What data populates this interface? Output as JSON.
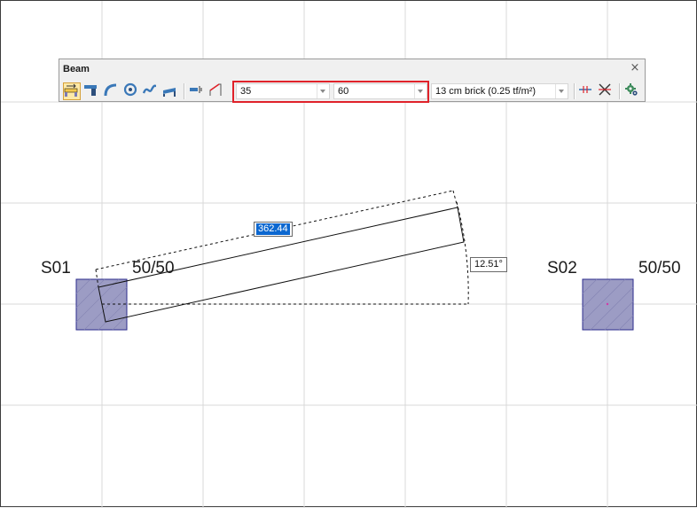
{
  "toolbar": {
    "title": "Beam",
    "close_glyph": "×",
    "width_value": "35",
    "height_value": "60",
    "wall_load_value": "13 cm brick (0.25 tf/m²)",
    "buttons": [
      {
        "icon": "straight-beam-icon",
        "active": true
      },
      {
        "icon": "cantilever-beam-icon",
        "active": false
      },
      {
        "icon": "arc-beam-icon",
        "active": false
      },
      {
        "icon": "circular-beam-icon",
        "active": false
      },
      {
        "icon": "spline-beam-icon",
        "active": false
      },
      {
        "icon": "inclined-beam-icon",
        "active": false
      },
      {
        "icon": "beam-offset-icon",
        "active": false
      },
      {
        "icon": "sloped-beam-icon",
        "active": false
      },
      {
        "icon": "split-beam-icon",
        "active": false
      },
      {
        "icon": "intersect-beams-icon",
        "active": false
      },
      {
        "icon": "beam-settings-icon",
        "active": false
      }
    ]
  },
  "drawing": {
    "column_left": {
      "name": "S01",
      "size": "50/50"
    },
    "column_right": {
      "name": "S02",
      "size": "50/50"
    },
    "length_input": "362.44",
    "angle_readout": "12.51°",
    "colors": {
      "column_fill": "#9c9cc4",
      "column_stroke": "#2b2b8c",
      "grid": "#d8d8d8",
      "selection": "#0b67d0",
      "highlight": "#e0222a"
    }
  }
}
